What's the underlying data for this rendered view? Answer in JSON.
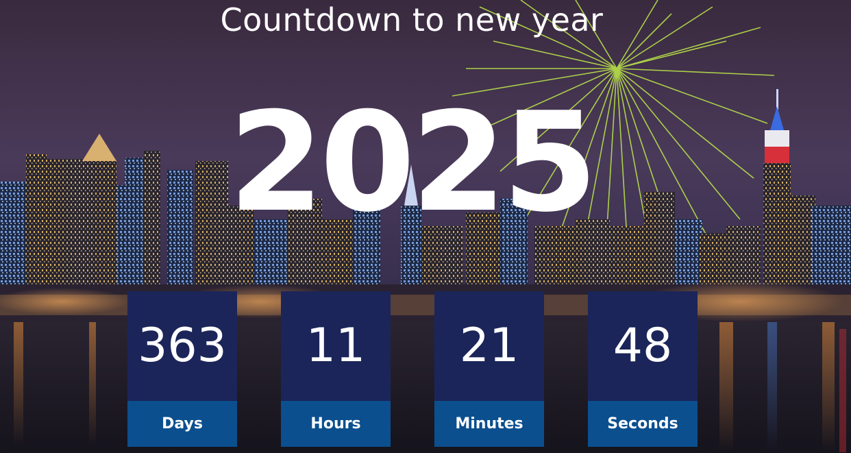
{
  "title": "Countdown to new year",
  "year": "2025",
  "countdown": [
    {
      "value": "363",
      "label": "Days"
    },
    {
      "value": "11",
      "label": "Hours"
    },
    {
      "value": "21",
      "label": "Minutes"
    },
    {
      "value": "48",
      "label": "Seconds"
    }
  ],
  "colors": {
    "card_number_bg": "#1b2559",
    "card_label_bg": "#0b4f8e",
    "firework": "#b8e24a",
    "text": "#ffffff"
  }
}
